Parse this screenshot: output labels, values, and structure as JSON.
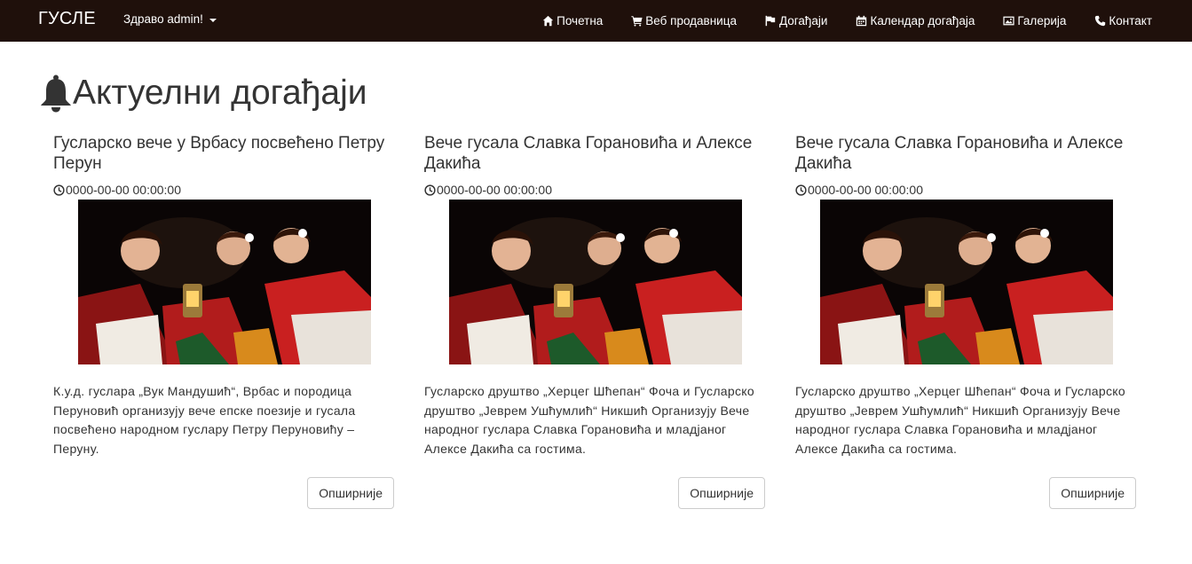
{
  "navbar": {
    "brand": "ГУСЛЕ",
    "user_menu": "Здраво admin!",
    "links": [
      {
        "label": "Почетна",
        "icon": "home-icon"
      },
      {
        "label": "Веб продавница",
        "icon": "shopping-cart-icon"
      },
      {
        "label": "Догађаји",
        "icon": "flag-icon"
      },
      {
        "label": "Календар догађаја",
        "icon": "calendar-icon"
      },
      {
        "label": "Галерија",
        "icon": "picture-icon"
      },
      {
        "label": "Контакт",
        "icon": "phone-icon"
      }
    ]
  },
  "page": {
    "title": "Актуелни догађаји",
    "title_icon": "bell-icon"
  },
  "events": [
    {
      "title": "Гусларско вече у Врбасу посвећено Петру Перун",
      "date": "0000-00-00 00:00:00",
      "description": "К.у.д. гуслара „Вук Мандушић“, Врбас и породица Перуновић организују вече епске поезије и гусала посвећено народном гуслару Петру Перуновићу – Перуну.",
      "button": "Опширније"
    },
    {
      "title": "Вече гусала Славка Горановића и Алексе Дакића",
      "date": "0000-00-00 00:00:00",
      "description": "Гусларско друштво „Херцег Шћепан“ Фоча и Гусларско друштво „Јеврем Ушћумлић“ Никшић Организују Вече народног гуслара Славка Горановића и младјаног Алексе Дакића са гостима.",
      "button": "Опширније"
    },
    {
      "title": "Вече гусала Славка Горановића и Алексе Дакића",
      "date": "0000-00-00 00:00:00",
      "description": "Гусларско друштво „Херцег Шћепан“ Фоча и Гусларско друштво „Јеврем Ушћумлић“ Никшић Организују Вече народног гуслара Славка Горановића и младјаног Алексе Дакића са гостима.",
      "button": "Опширније"
    }
  ],
  "colors": {
    "navbar_bg": "#1f100b",
    "text": "#333333",
    "button_border": "#cccccc"
  }
}
